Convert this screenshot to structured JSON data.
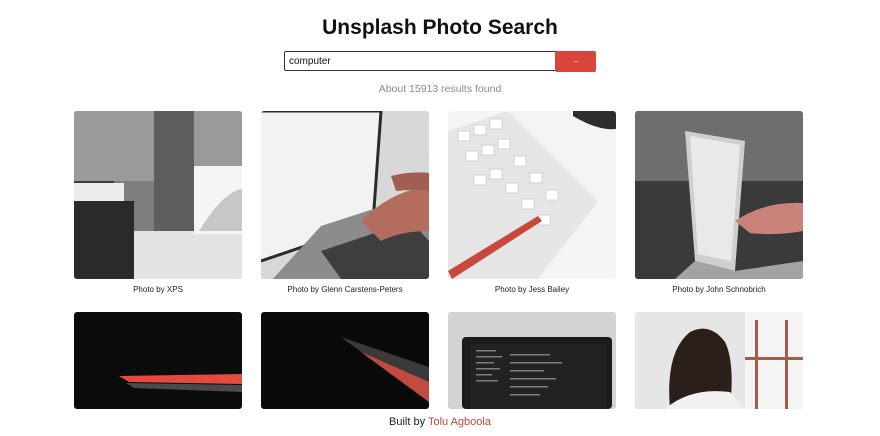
{
  "header": {
    "title": "Unsplash Photo Search"
  },
  "search": {
    "value": "computer"
  },
  "results": {
    "text": "About 15913 results found"
  },
  "photos": [
    {
      "caption": "Photo by XPS"
    },
    {
      "caption": "Photo by Glenn Carstens-Peters"
    },
    {
      "caption": "Photo by Jess Bailey"
    },
    {
      "caption": "Photo by John Schnobrich"
    }
  ],
  "footer": {
    "prefix": "Built by",
    "author": "Tolu Agboola"
  },
  "colors": {
    "accent": "#d9453a",
    "link": "#c0463c",
    "muted": "#8b8b8b"
  }
}
